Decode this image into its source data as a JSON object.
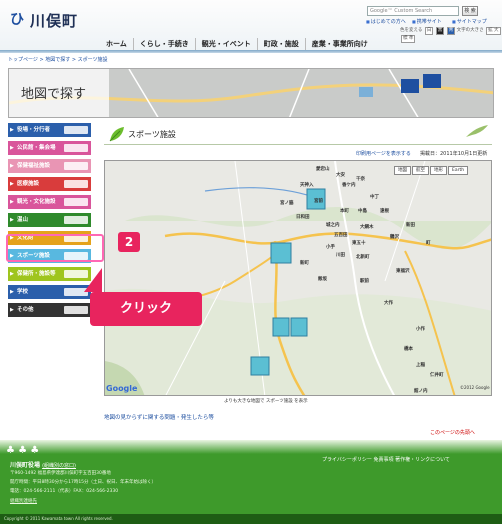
{
  "header": {
    "logo_mark": "ひ",
    "site_name": "川俣町",
    "search_placeholder": "Google™ Custom Search",
    "search_button": "検 索",
    "top_links": [
      "はじめての方へ",
      "携帯サイト",
      "サイトマップ"
    ],
    "accessibility_label": "色を変える",
    "color_buttons": [
      "白",
      "黒",
      "青"
    ],
    "text_size_label": "文字の大きさ",
    "text_size_buttons": [
      "拡 大",
      "標 準"
    ]
  },
  "nav": {
    "items": [
      "ホーム",
      "くらし・手続き",
      "観光・イベント",
      "町政・施設",
      "産業・事業所向け"
    ]
  },
  "breadcrumb": "トップページ > 地図で探す > スポーツ施設",
  "map_banner": {
    "title": "地図で探す"
  },
  "sidebar": {
    "items": [
      {
        "label": "役場・分行者",
        "color": "#2b5fab"
      },
      {
        "label": "公民館・集会場",
        "color": "#d9559b"
      },
      {
        "label": "保健福祉施設",
        "color": "#e995b4"
      },
      {
        "label": "医療施設",
        "color": "#d93c3c"
      },
      {
        "label": "観光・文化施設",
        "color": "#d9559b"
      },
      {
        "label": "温山",
        "color": "#2f8a2c"
      },
      {
        "label": "文化財",
        "color": "#e5a21a"
      },
      {
        "label": "スポーツ施設",
        "color": "#58b8e0"
      },
      {
        "label": "保健所・施設等",
        "color": "#9fc51e"
      },
      {
        "label": "学校",
        "color": "#2b5fab"
      },
      {
        "label": "その他",
        "color": "#333333"
      }
    ]
  },
  "overlay": {
    "step": "2",
    "click": "クリック"
  },
  "main": {
    "title": "スポーツ施設",
    "print_link": "印刷用ページを表示する",
    "updated": "掲載日：2011年10月1日更新",
    "map_types": [
      "地図",
      "航空",
      "地形",
      "Earth"
    ],
    "map_labels": [
      "Google",
      "©2012 Google"
    ],
    "caption": "よりも大きな地図で スポーツ施設 を表示",
    "report_link": "地図の見からずに関する問題・発生したら等",
    "pagetop_link": "このページの先頭へ"
  },
  "map_places": [
    "愛宕山",
    "大安",
    "天神入",
    "香ケ内",
    "千奈",
    "宮ノ脇",
    "宮前",
    "中丁",
    "本町",
    "中島",
    "遠根",
    "日和田",
    "城之内",
    "大綱木",
    "新田",
    "五百田",
    "東五十",
    "鶴沢",
    "小手",
    "川田",
    "北新町",
    "新町",
    "飯坂",
    "東福沢",
    "駅前",
    "町",
    "大作",
    "小作",
    "橋本",
    "上稲",
    "仁井町",
    "館ノ内"
  ],
  "footer": {
    "links": "プライバシーポリシー  免責事項  著作権・リンクについて",
    "org": "川俣町役場",
    "org_link": "(組織別の窓口)",
    "lines": [
      "〒960-1492 福島県伊達郡川俣町字五百田30番地",
      "開庁時間：平日8時30分から17時15分（土日、祝日、年末年始は除く）",
      "電話：024-566-2111（代表）FAX：024-566-2330",
      "組織別連絡先"
    ],
    "copyright": "Copyright © 2011 Kawamata town All rights reserved."
  }
}
